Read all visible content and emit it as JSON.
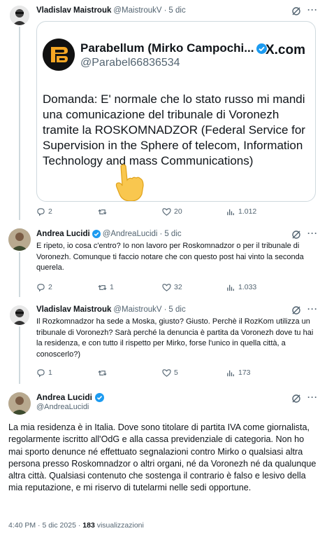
{
  "tweet1": {
    "name": "Vladislav Maistrouk",
    "handle": "@MaistroukV",
    "dot": "·",
    "time": "5 dic",
    "card": {
      "name": "Parabellum (Mirko Campochi...",
      "handle": "@Parabel66836534",
      "brand": "X.com",
      "text": "Domanda: E' normale che lo stato russo  mi mandi una comunicazione del tribunale di Voronezh tramite la ROSKOMNADZOR (Federal Service for Supervision in the Sphere of telecom, Information Technology and mass Communications)"
    },
    "actions": {
      "replies": "2",
      "retweets": "",
      "likes": "20",
      "views": "1.012"
    }
  },
  "tweet2": {
    "name": "Andrea Lucidi",
    "handle": "@AndreaLucidi",
    "dot": "·",
    "time": "5 dic",
    "text": "E ripeto, io cosa c'entro? Io non lavoro per Roskomnadzor o per il tribunale di Voronezh. Comunque ti faccio notare che con questo post hai vinto la seconda querela.",
    "actions": {
      "replies": "2",
      "retweets": "1",
      "likes": "32",
      "views": "1.033"
    }
  },
  "tweet3": {
    "name": "Vladislav Maistrouk",
    "handle": "@MaistroukV",
    "dot": "·",
    "time": "5 dic",
    "text": "Il Rozkomnadzor ha sede a Moska, giusto? Giusto. Perchè il RozKom utilizza un tribunale di Voronezh? Sarà perché la denuncia è partita da Voronezh dove tu hai la residenza, e con tutto il rispetto per Mirko, forse l'unico in quella città, a conoscerlo?)",
    "actions": {
      "replies": "1",
      "retweets": "",
      "likes": "5",
      "views": "173"
    }
  },
  "tweet4": {
    "name": "Andrea Lucidi",
    "handle": "@AndreaLucidi",
    "text": "La mia residenza è  in Italia. Dove sono titolare di partita IVA come giornalista, regolarmente iscritto all'OdG e alla cassa previdenziale di categoria. Non ho mai sporto denunce né effettuato segnalazioni contro Mirko o qualsiasi altra persona presso Roskomnadzor o altri organi, né da Voronezh né da qualunque altra città. Qualsiasi contenuto che sostenga il contrario è falso e lesivo della mia reputazione, e mi riservo di tutelarmi nelle sedi opportune.",
    "time": "4:40 PM",
    "dot": "·",
    "date": "5 dic 2025",
    "views_count": "183",
    "views_label": "visualizzazioni"
  },
  "colors": {
    "verified": "#1d9bf0",
    "muted": "#536471",
    "border": "#cfd9de",
    "text": "#0f1419"
  },
  "icons": [
    "reply-icon",
    "retweet-icon",
    "like-icon",
    "views-icon",
    "grok-icon",
    "more-icon",
    "verified-icon",
    "pointing-hand-emoji"
  ]
}
